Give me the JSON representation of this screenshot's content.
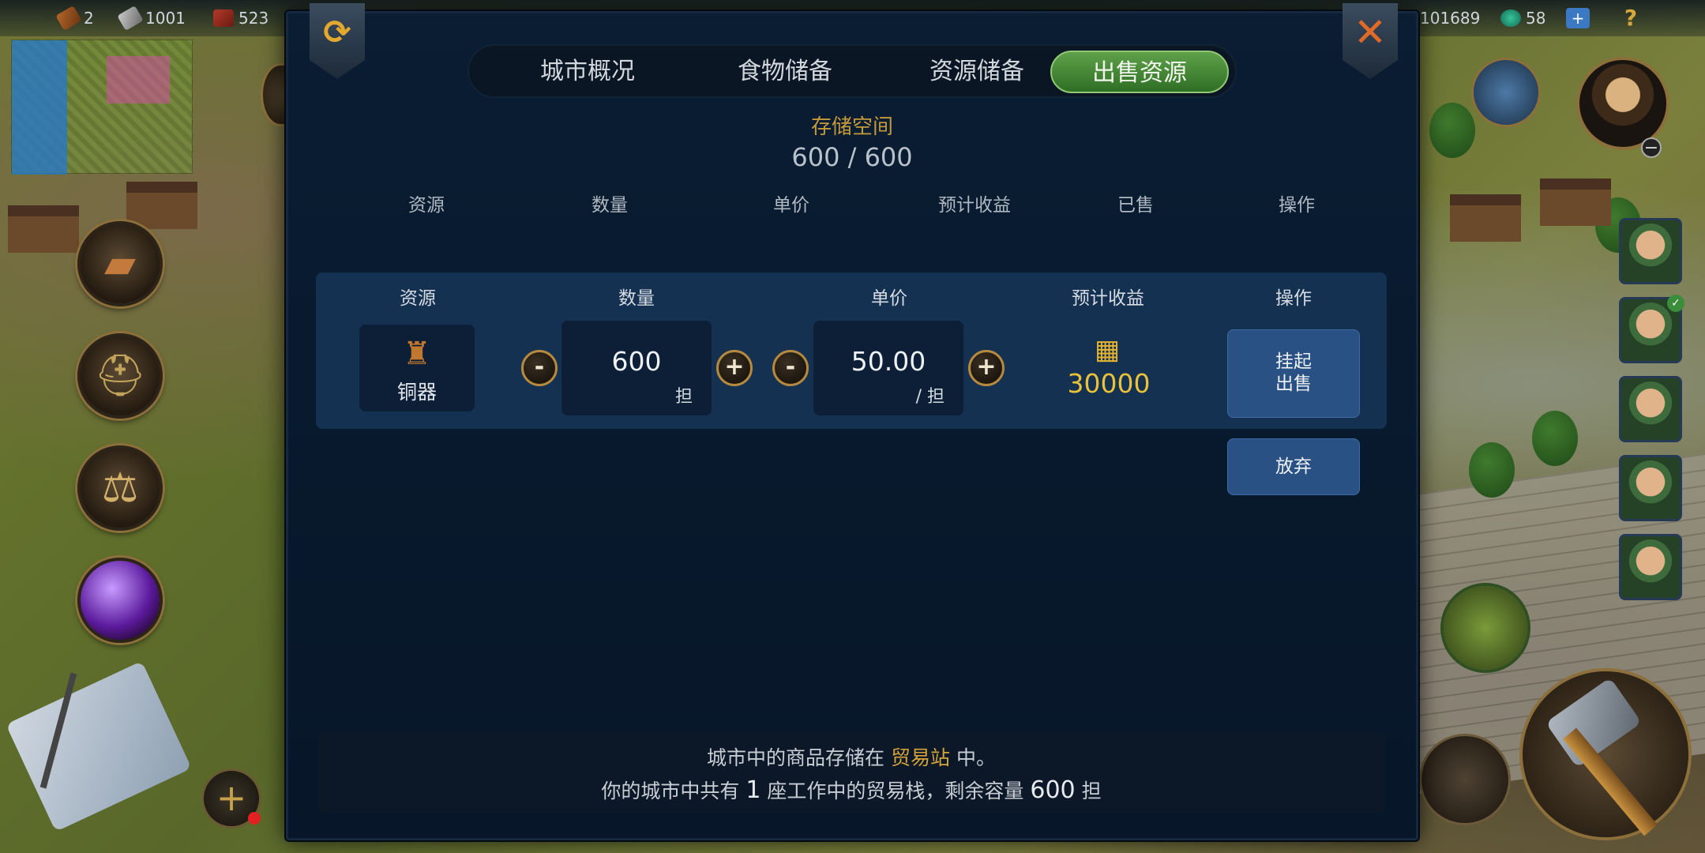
{
  "topbar": {
    "wood": "2",
    "iron": "1001",
    "brick": "523",
    "gold": "101689",
    "gems": "58",
    "gem_plus": "+",
    "help": "?"
  },
  "hud": {
    "add_plus": "+"
  },
  "dialog": {
    "tabs": [
      "城市概况",
      "食物储备",
      "资源储备",
      "出售资源"
    ],
    "active_tab": 3,
    "storage_title": "存储空间",
    "storage_value": "600 / 600",
    "headers": [
      "资源",
      "数量",
      "单价",
      "预计收益",
      "已售",
      "操作"
    ],
    "row_headers": [
      "资源",
      "数量",
      "单价",
      "预计收益",
      "操作"
    ],
    "row": {
      "resource_name": "铜器",
      "resource_icon": "bronze-vessel-icon",
      "quantity": "600",
      "quantity_unit": "担",
      "price": "50.00",
      "price_unit": "/ 担",
      "expected_income": "30000",
      "sell_button": "挂起\n出售",
      "sell_line1": "挂起",
      "sell_line2": "出售",
      "abandon_button": "放弃"
    },
    "info": {
      "line1_pre": "城市中的商品存储在",
      "line1_highlight": "贸易站",
      "line1_post": "中。",
      "line2_pre": "你的城市中共有",
      "line2_count": "1",
      "line2_mid": "座工作中的贸易栈，剩余容量",
      "line2_capacity": "600",
      "line2_unit": "担"
    }
  },
  "colors": {
    "active_tab": "#3f8a33",
    "gold_text": "#e9c23a",
    "accent_gold": "#c49a3a",
    "button_blue": "#2a5183",
    "panel_row": "#143152",
    "dialog_bg": "#0a1d33"
  }
}
